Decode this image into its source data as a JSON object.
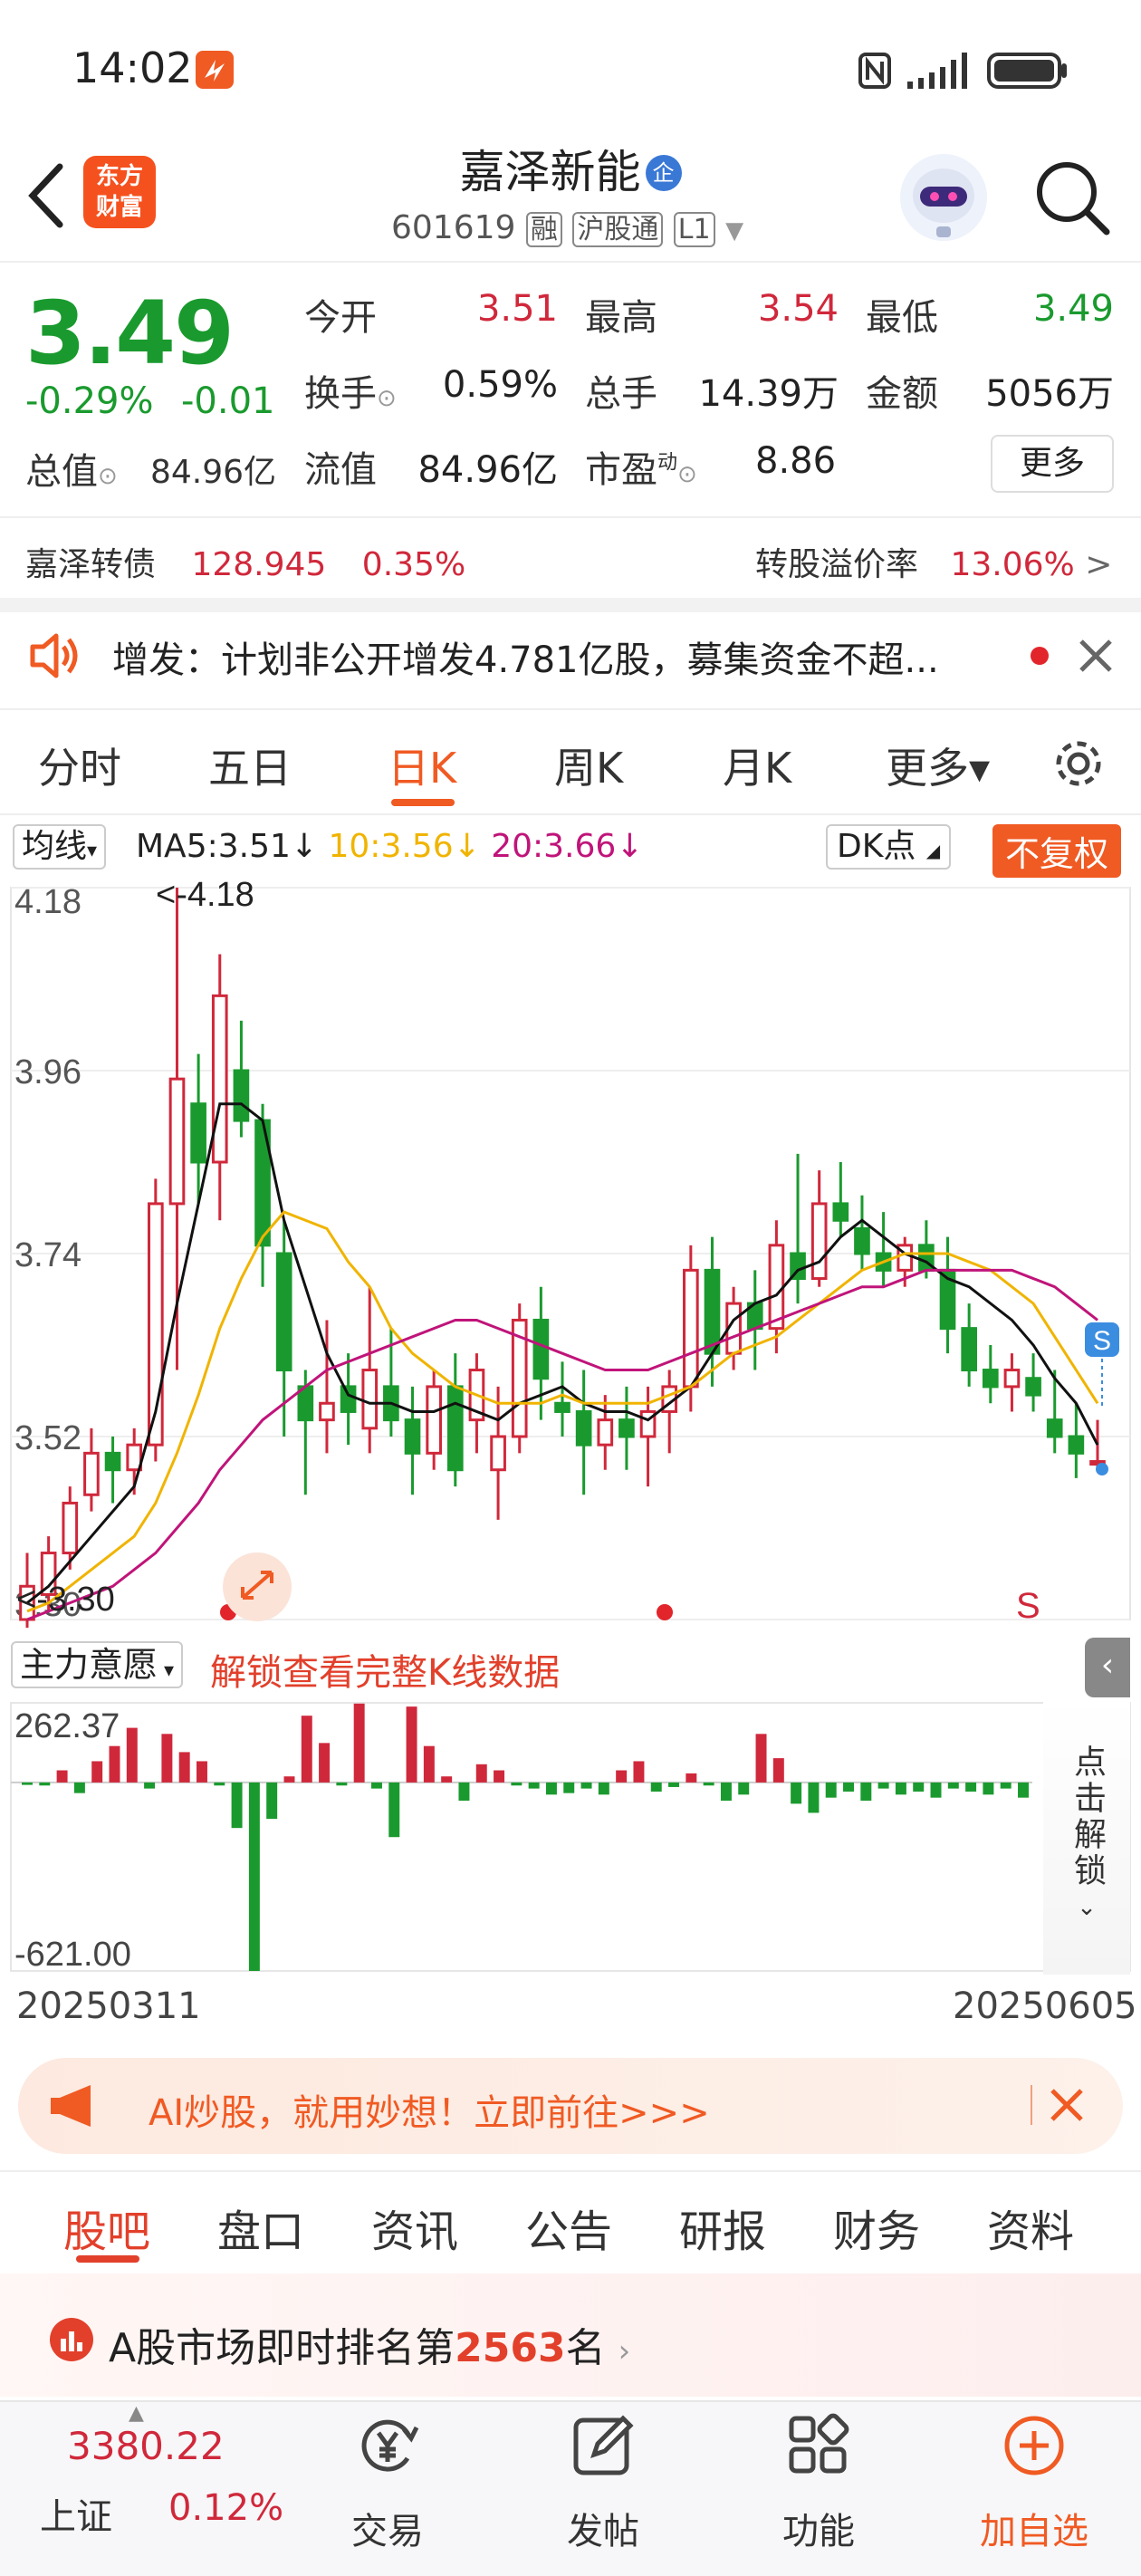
{
  "status": {
    "time": "14:02"
  },
  "header": {
    "stock_name": "嘉泽新能",
    "enterprise_badge": "企",
    "code": "601619",
    "tags": [
      "融",
      "沪股通",
      "L1"
    ],
    "logo_text": [
      "东方",
      "财富"
    ]
  },
  "quote": {
    "price": "3.49",
    "change_pct": "-0.29%",
    "change": "-0.01",
    "open_label": "今开",
    "open": "3.51",
    "high_label": "最高",
    "high": "3.54",
    "low_label": "最低",
    "low": "3.49",
    "turnover_label": "换手",
    "turnover": "0.59%",
    "volume_label": "总手",
    "volume": "14.39万",
    "amount_label": "金额",
    "amount": "5056万",
    "mktcap_label": "总值",
    "mktcap": "84.96亿",
    "float_label": "流值",
    "float_cap": "84.96亿",
    "pe_label": "市盈",
    "pe_sup": "动",
    "pe": "8.86",
    "more_label": "更多"
  },
  "bond": {
    "name": "嘉泽转债",
    "price": "128.945",
    "pct": "0.35%",
    "premium_label": "转股溢价率",
    "premium": "13.06%"
  },
  "notice": {
    "text": "增发：计划非公开增发4.781亿股，募集资金不超..."
  },
  "period_tabs": [
    {
      "label": "分时"
    },
    {
      "label": "五日"
    },
    {
      "label": "日K"
    },
    {
      "label": "周K"
    },
    {
      "label": "月K"
    },
    {
      "label": "更多▾"
    }
  ],
  "chart_controls": {
    "ma_select": "均线",
    "ma5": "MA5:3.51↓",
    "ma10": "10:3.56↓",
    "ma20": "20:3.66↓",
    "dk_label": "DK点",
    "fq_label": "不复权"
  },
  "chart_data": {
    "type": "candlestick",
    "y_ticks": [
      "4.18",
      "3.96",
      "3.74",
      "3.52",
      "3.30"
    ],
    "ylim": [
      3.3,
      4.18
    ],
    "max_note": "<-4.18",
    "min_note": "<-3.30",
    "signal": "S",
    "candles": [
      [
        3.3,
        3.38,
        3.29,
        3.34
      ],
      [
        3.33,
        3.4,
        3.31,
        3.38
      ],
      [
        3.38,
        3.46,
        3.36,
        3.44
      ],
      [
        3.45,
        3.53,
        3.43,
        3.5
      ],
      [
        3.5,
        3.52,
        3.44,
        3.48
      ],
      [
        3.48,
        3.53,
        3.45,
        3.51
      ],
      [
        3.51,
        3.83,
        3.49,
        3.8
      ],
      [
        3.8,
        4.18,
        3.6,
        3.95
      ],
      [
        3.92,
        3.98,
        3.8,
        3.85
      ],
      [
        3.85,
        4.1,
        3.78,
        4.05
      ],
      [
        3.96,
        4.02,
        3.88,
        3.9
      ],
      [
        3.9,
        3.92,
        3.7,
        3.75
      ],
      [
        3.74,
        3.78,
        3.52,
        3.6
      ],
      [
        3.58,
        3.6,
        3.45,
        3.54
      ],
      [
        3.54,
        3.66,
        3.5,
        3.56
      ],
      [
        3.58,
        3.62,
        3.51,
        3.55
      ],
      [
        3.53,
        3.7,
        3.5,
        3.6
      ],
      [
        3.58,
        3.65,
        3.52,
        3.54
      ],
      [
        3.54,
        3.58,
        3.45,
        3.5
      ],
      [
        3.5,
        3.6,
        3.48,
        3.58
      ],
      [
        3.58,
        3.62,
        3.46,
        3.48
      ],
      [
        3.54,
        3.62,
        3.5,
        3.6
      ],
      [
        3.48,
        3.58,
        3.42,
        3.52
      ],
      [
        3.52,
        3.68,
        3.5,
        3.66
      ],
      [
        3.66,
        3.7,
        3.54,
        3.59
      ],
      [
        3.56,
        3.61,
        3.52,
        3.55
      ],
      [
        3.55,
        3.6,
        3.45,
        3.51
      ],
      [
        3.51,
        3.57,
        3.48,
        3.54
      ],
      [
        3.54,
        3.58,
        3.48,
        3.52
      ],
      [
        3.52,
        3.58,
        3.46,
        3.55
      ],
      [
        3.55,
        3.6,
        3.5,
        3.58
      ],
      [
        3.58,
        3.75,
        3.55,
        3.72
      ],
      [
        3.72,
        3.76,
        3.58,
        3.62
      ],
      [
        3.62,
        3.7,
        3.6,
        3.68
      ],
      [
        3.68,
        3.72,
        3.6,
        3.65
      ],
      [
        3.65,
        3.78,
        3.62,
        3.75
      ],
      [
        3.74,
        3.86,
        3.68,
        3.71
      ],
      [
        3.71,
        3.84,
        3.7,
        3.8
      ],
      [
        3.8,
        3.85,
        3.76,
        3.78
      ],
      [
        3.77,
        3.81,
        3.72,
        3.74
      ],
      [
        3.74,
        3.79,
        3.7,
        3.72
      ],
      [
        3.72,
        3.76,
        3.7,
        3.75
      ],
      [
        3.75,
        3.78,
        3.71,
        3.72
      ],
      [
        3.72,
        3.76,
        3.62,
        3.65
      ],
      [
        3.65,
        3.68,
        3.58,
        3.6
      ],
      [
        3.6,
        3.63,
        3.56,
        3.58
      ],
      [
        3.58,
        3.62,
        3.55,
        3.6
      ],
      [
        3.59,
        3.62,
        3.55,
        3.57
      ],
      [
        3.54,
        3.6,
        3.5,
        3.52
      ],
      [
        3.52,
        3.56,
        3.47,
        3.5
      ],
      [
        3.49,
        3.54,
        3.48,
        3.49
      ]
    ],
    "ma5": [
      3.32,
      3.34,
      3.37,
      3.4,
      3.43,
      3.46,
      3.55,
      3.68,
      3.8,
      3.92,
      3.92,
      3.9,
      3.78,
      3.7,
      3.62,
      3.57,
      3.56,
      3.56,
      3.55,
      3.55,
      3.56,
      3.55,
      3.54,
      3.56,
      3.57,
      3.58,
      3.56,
      3.55,
      3.55,
      3.54,
      3.56,
      3.58,
      3.62,
      3.66,
      3.68,
      3.69,
      3.72,
      3.73,
      3.76,
      3.78,
      3.76,
      3.74,
      3.73,
      3.71,
      3.7,
      3.68,
      3.66,
      3.63,
      3.59,
      3.56,
      3.51
    ],
    "ma10": [
      3.31,
      3.32,
      3.34,
      3.36,
      3.38,
      3.4,
      3.44,
      3.5,
      3.57,
      3.65,
      3.71,
      3.76,
      3.79,
      3.78,
      3.77,
      3.73,
      3.7,
      3.65,
      3.62,
      3.6,
      3.58,
      3.57,
      3.56,
      3.56,
      3.56,
      3.57,
      3.56,
      3.56,
      3.56,
      3.56,
      3.57,
      3.58,
      3.6,
      3.62,
      3.63,
      3.64,
      3.66,
      3.68,
      3.7,
      3.72,
      3.73,
      3.74,
      3.74,
      3.74,
      3.73,
      3.72,
      3.7,
      3.68,
      3.64,
      3.6,
      3.56
    ],
    "ma20": [
      3.3,
      3.31,
      3.32,
      3.33,
      3.34,
      3.36,
      3.38,
      3.41,
      3.44,
      3.48,
      3.51,
      3.54,
      3.56,
      3.58,
      3.6,
      3.61,
      3.62,
      3.63,
      3.64,
      3.65,
      3.66,
      3.66,
      3.65,
      3.64,
      3.63,
      3.62,
      3.61,
      3.6,
      3.6,
      3.6,
      3.61,
      3.62,
      3.63,
      3.64,
      3.65,
      3.66,
      3.67,
      3.68,
      3.69,
      3.7,
      3.7,
      3.71,
      3.72,
      3.72,
      3.72,
      3.72,
      3.72,
      3.71,
      3.7,
      3.68,
      3.66
    ],
    "dates": [
      "20250311",
      "20250605"
    ]
  },
  "sub_chart": {
    "indicator": "主力意愿",
    "unlock_text": "解锁查看完整K线数据",
    "max": "262.37",
    "min": "-621.00",
    "side_text": "点击解锁",
    "values": [
      -8,
      -10,
      40,
      -35,
      70,
      120,
      180,
      -20,
      160,
      100,
      70,
      -10,
      -150,
      -621,
      -120,
      20,
      220,
      130,
      -10,
      260,
      -20,
      -180,
      250,
      120,
      20,
      -60,
      60,
      40,
      -10,
      -20,
      -40,
      -35,
      -20,
      -40,
      40,
      70,
      -30,
      -15,
      30,
      -10,
      -60,
      -40,
      160,
      80,
      -70,
      -100,
      -50,
      -30,
      -60,
      -20,
      -40,
      -30,
      -50,
      -20,
      -30,
      -40,
      -20,
      -50
    ]
  },
  "ad": {
    "text": "AI炒股，就用妙想！立即前往>>>"
  },
  "bottom_tabs": [
    {
      "label": "股吧"
    },
    {
      "label": "盘口"
    },
    {
      "label": "资讯"
    },
    {
      "label": "公告"
    },
    {
      "label": "研报"
    },
    {
      "label": "财务"
    },
    {
      "label": "资料"
    }
  ],
  "rank": {
    "prefix": "A股市场即时排名第",
    "num": "2563",
    "suffix": "名"
  },
  "index": {
    "name": "上证",
    "value": "3380.22",
    "pct": "0.12%"
  },
  "nav": [
    {
      "label": "交易",
      "icon": "yen-cycle-icon"
    },
    {
      "label": "发帖",
      "icon": "edit-icon"
    },
    {
      "label": "功能",
      "icon": "grid-icon"
    },
    {
      "label": "加自选",
      "icon": "plus-circle-icon"
    }
  ]
}
